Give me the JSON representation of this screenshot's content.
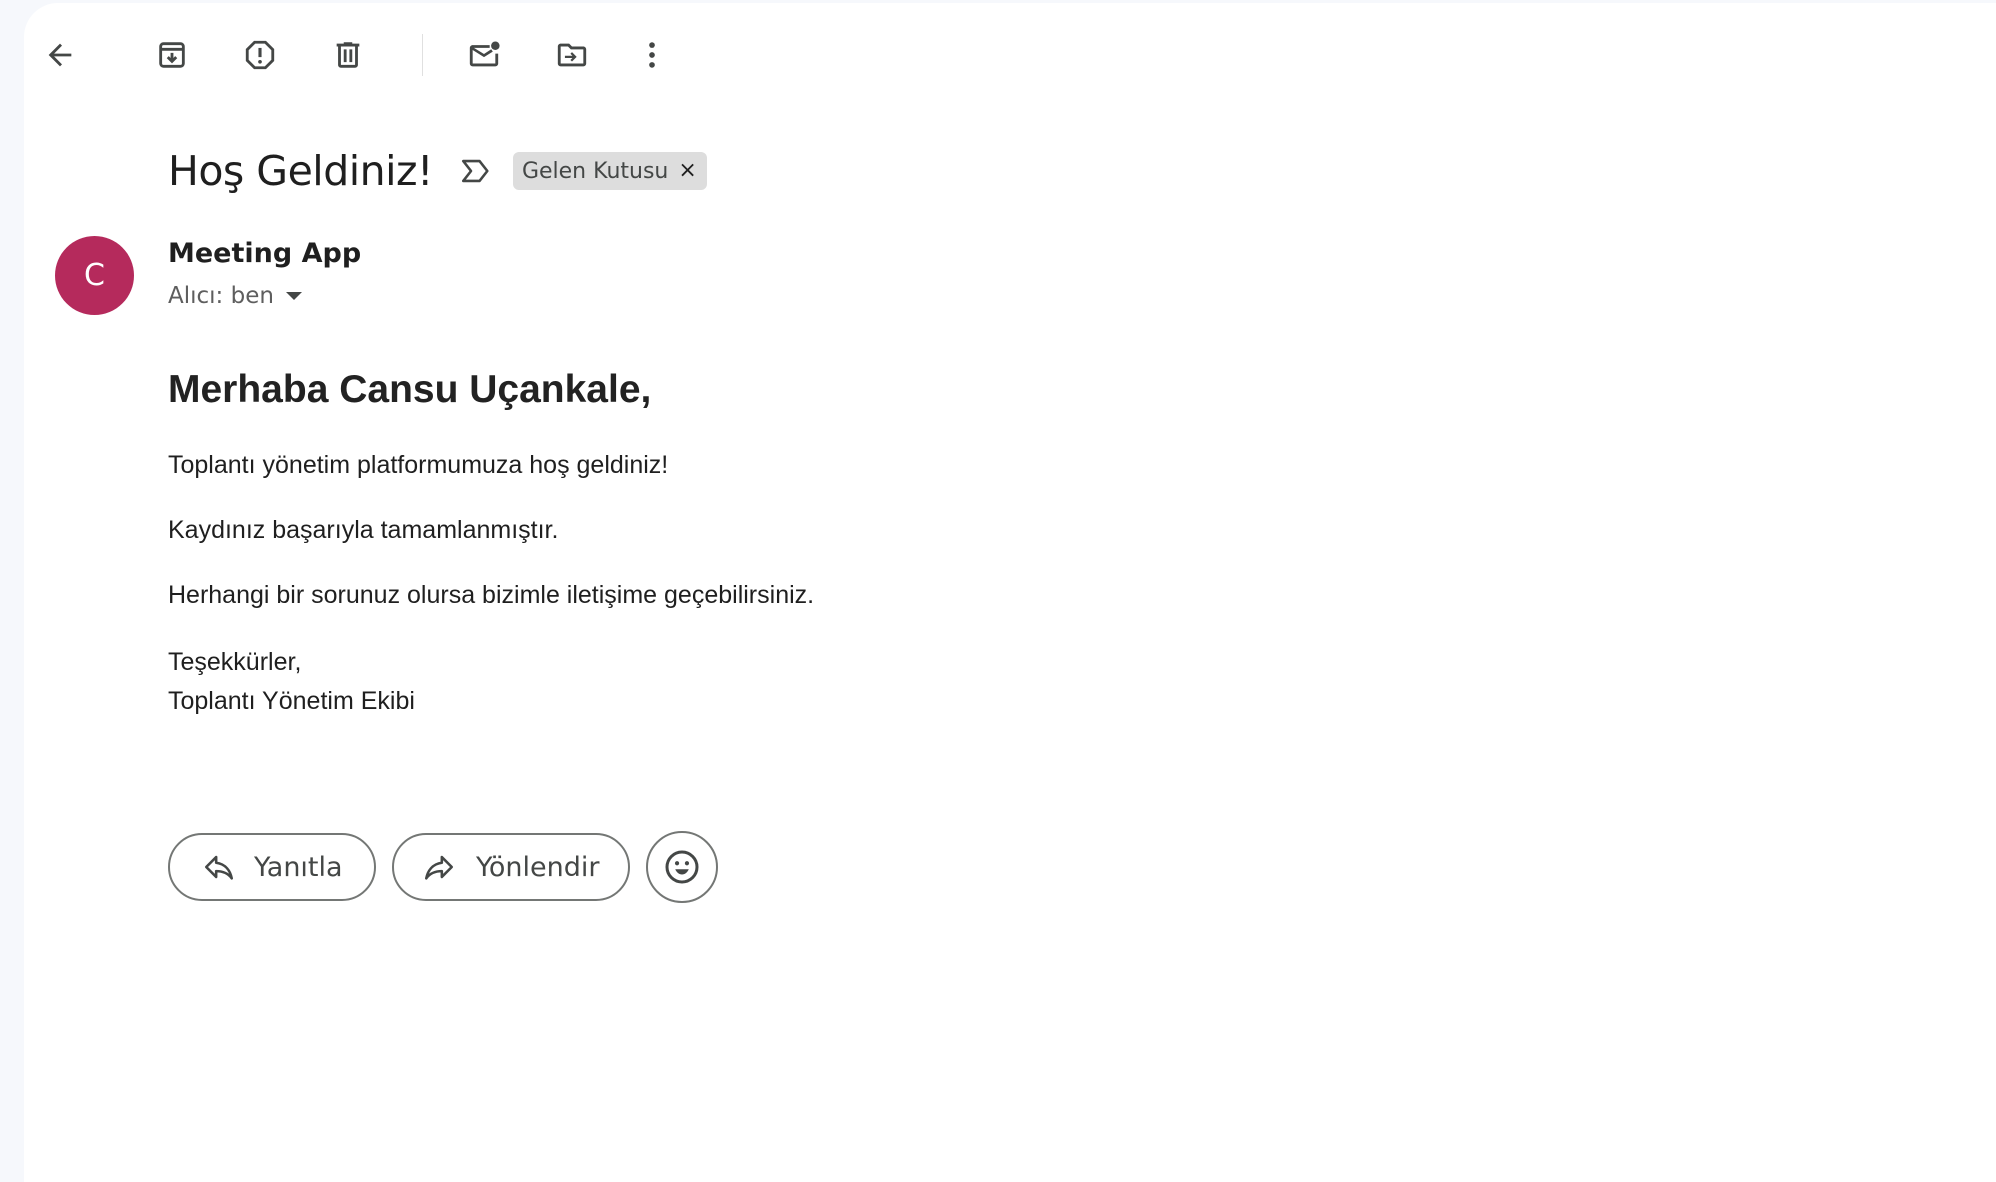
{
  "toolbar": {
    "icons": [
      "back-arrow-icon",
      "archive-icon",
      "report-spam-icon",
      "delete-icon",
      "mark-unread-icon",
      "move-to-icon",
      "more-options-icon"
    ]
  },
  "email": {
    "subject": "Hoş Geldiniz!",
    "label": "Gelen Kutusu",
    "label_close": "×",
    "sender": {
      "initial": "C",
      "name": "Meeting App",
      "recipient": "Alıcı: ben",
      "avatar_color": "#b52a5c"
    },
    "body": {
      "greeting": "Merhaba Cansu Uçankale,",
      "paragraphs": [
        "Toplantı yönetim platformumuza hoş geldiniz!",
        "Kaydınız başarıyla tamamlanmıştır.",
        "Herhangi bir sorunuz olursa bizimle iletişime geçebilirsiniz."
      ],
      "closing": "Teşekkürler,",
      "signature": "Toplantı Yönetim Ekibi"
    }
  },
  "actions": {
    "reply": "Yanıtla",
    "forward": "Yönlendir"
  }
}
